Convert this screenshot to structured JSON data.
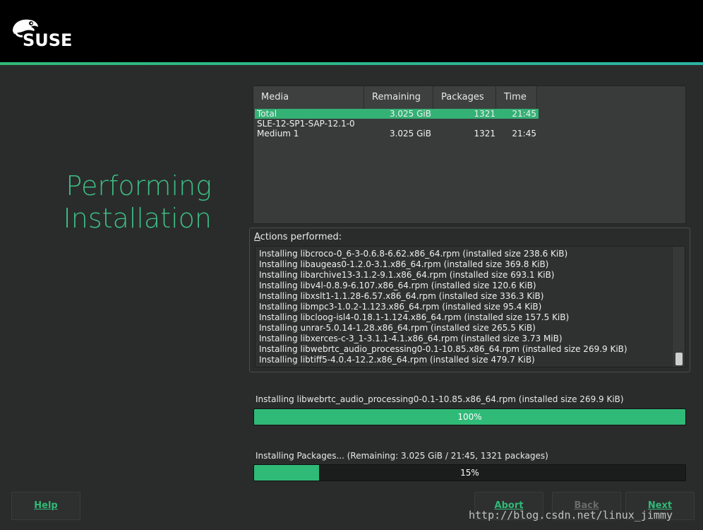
{
  "header": {
    "logo_text": "SUSE",
    "accent_color": "#30ba78"
  },
  "page_title": {
    "line1": "Performing",
    "line2": "Installation"
  },
  "media_table": {
    "columns": [
      "Media",
      "Remaining",
      "Packages",
      "Time"
    ],
    "rows": [
      {
        "name": "Total",
        "remaining": "3.025 GiB",
        "packages": "1321",
        "time": "21:45",
        "selected": true
      },
      {
        "name": "SLE-12-SP1-SAP-12.1-0",
        "remaining": "",
        "packages": "",
        "time": "",
        "selected": false
      },
      {
        "name": "Medium 1",
        "remaining": "3.025 GiB",
        "packages": "1321",
        "time": "21:45",
        "selected": false
      }
    ]
  },
  "actions": {
    "label_accel": "A",
    "label_rest": "ctions performed:",
    "log": [
      "Installing libcroco-0_6-3-0.6.8-6.62.x86_64.rpm (installed size 238.6 KiB)",
      "Installing libaugeas0-1.2.0-3.1.x86_64.rpm (installed size 369.8 KiB)",
      "Installing libarchive13-3.1.2-9.1.x86_64.rpm (installed size 693.1 KiB)",
      "Installing libv4l-0.8.9-6.107.x86_64.rpm (installed size 120.6 KiB)",
      "Installing libxslt1-1.1.28-6.57.x86_64.rpm (installed size 336.3 KiB)",
      "Installing libmpc3-1.0.2-1.123.x86_64.rpm (installed size 95.4 KiB)",
      "Installing libcloog-isl4-0.18.1-1.124.x86_64.rpm (installed size 157.5 KiB)",
      "Installing unrar-5.0.14-1.28.x86_64.rpm (installed size 265.5 KiB)",
      "Installing libxerces-c-3_1-3.1.1-4.1.x86_64.rpm (installed size 3.73 MiB)",
      "Installing libwebrtc_audio_processing0-0.1-10.85.x86_64.rpm (installed size 269.9 KiB)",
      "Installing libtiff5-4.0.4-12.2.x86_64.rpm (installed size 479.7 KiB)"
    ]
  },
  "current_package": {
    "label": "Installing libwebrtc_audio_processing0-0.1-10.85.x86_64.rpm (installed size 269.9 KiB)",
    "percent_text": "100%",
    "fraction": 1.0
  },
  "total_progress": {
    "label": "Installing Packages... (Remaining: 3.025 GiB / 21:45, 1321 packages)",
    "percent_text": "15%",
    "fraction": 0.15
  },
  "buttons": {
    "help": "Help",
    "abort": "Abort",
    "back": "Back",
    "next": "Next"
  },
  "watermark": "http://blog.csdn.net/linux_jimmy"
}
